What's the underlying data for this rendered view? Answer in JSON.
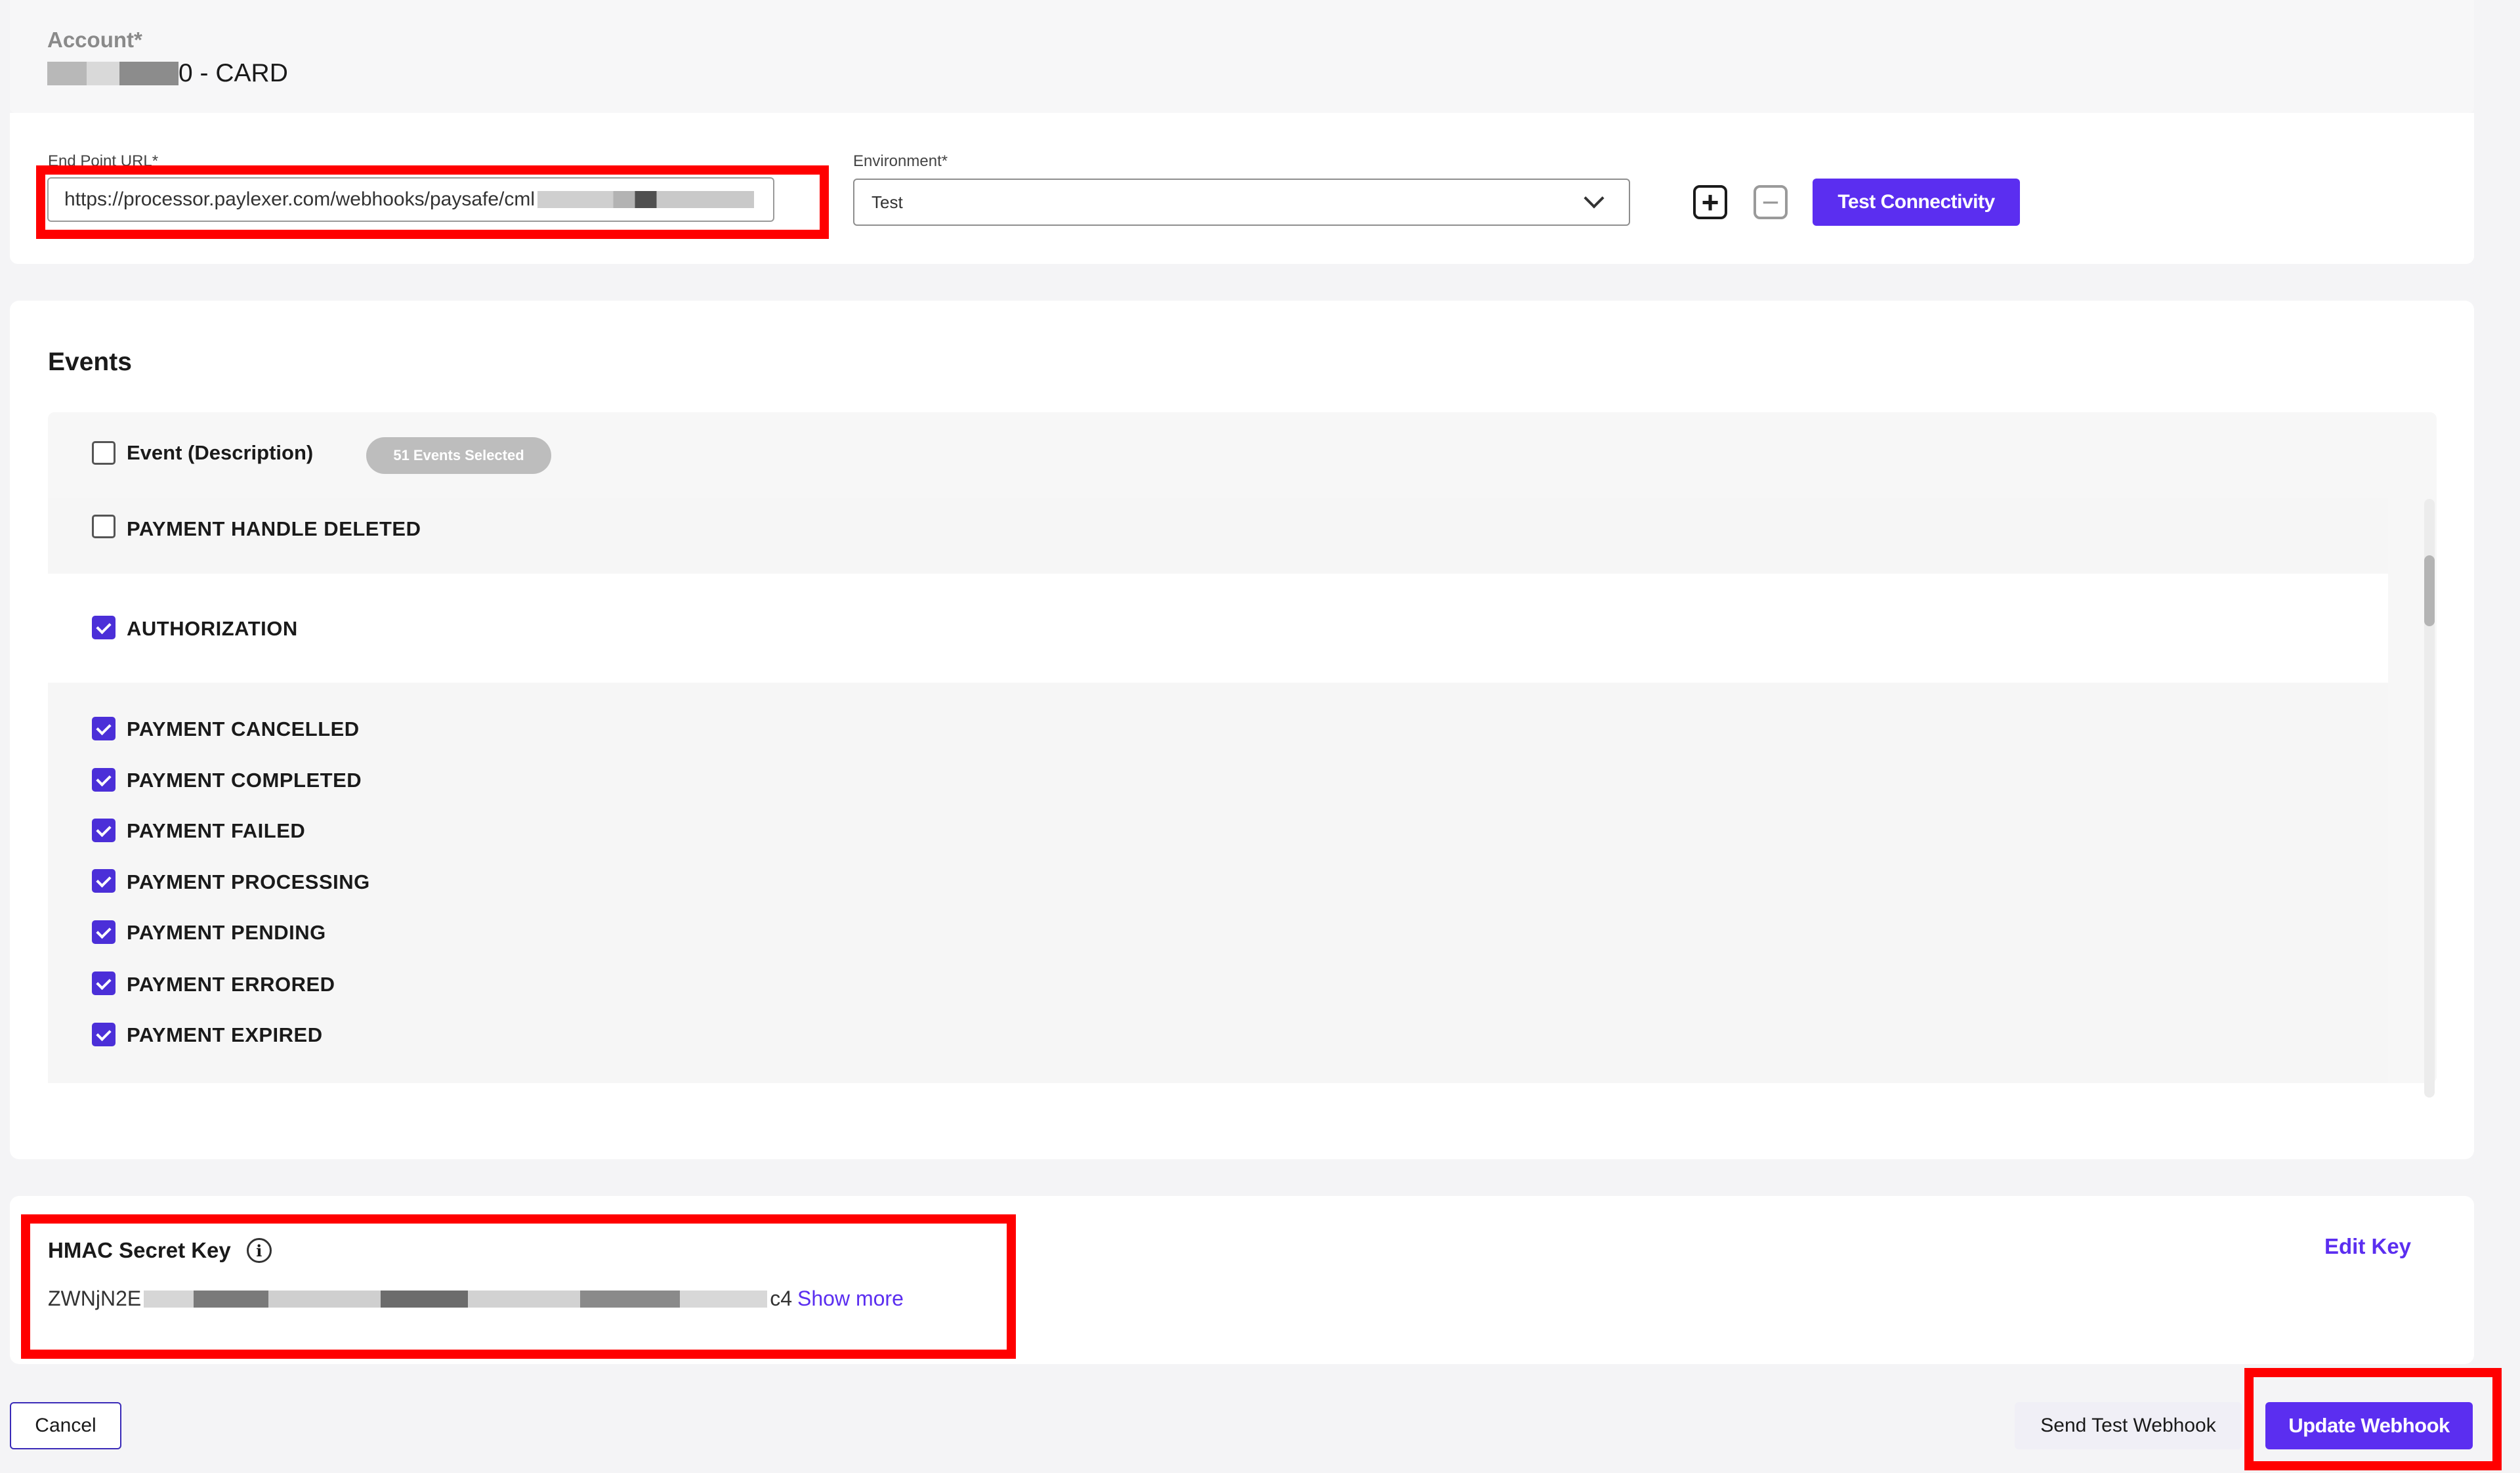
{
  "account": {
    "label": "Account*",
    "value_suffix": "0 - CARD"
  },
  "endpoint": {
    "label": "End Point URL*",
    "url_value": "https://processor.paylexer.com/webhooks/paysafe/cml",
    "env_label": "Environment*",
    "env_value": "Test",
    "test_connectivity_label": "Test Connectivity",
    "plus_symbol": "+",
    "minus_symbol": "−"
  },
  "events": {
    "title": "Events",
    "header_label": "Event (Description)",
    "selected_badge": "51 Events Selected",
    "items": [
      {
        "label": "PAYMENT HANDLE DELETED",
        "checked": false
      },
      {
        "label": "AUTHORIZATION",
        "checked": true
      },
      {
        "label": "PAYMENT CANCELLED",
        "checked": true
      },
      {
        "label": "PAYMENT COMPLETED",
        "checked": true
      },
      {
        "label": "PAYMENT FAILED",
        "checked": true
      },
      {
        "label": "PAYMENT PROCESSING",
        "checked": true
      },
      {
        "label": "PAYMENT PENDING",
        "checked": true
      },
      {
        "label": "PAYMENT ERRORED",
        "checked": true
      },
      {
        "label": "PAYMENT EXPIRED",
        "checked": true
      }
    ]
  },
  "hmac": {
    "title": "HMAC Secret Key",
    "info_symbol": "i",
    "value_prefix": "ZWNjN2E",
    "value_suffix": "c4",
    "show_more": "Show more",
    "edit_key": "Edit Key"
  },
  "footer": {
    "cancel_label": "Cancel",
    "send_test_label": "Send Test Webhook",
    "update_label": "Update Webhook"
  },
  "colors": {
    "accent": "#5b2ef0",
    "checkbox_checked": "#4b2fd8",
    "annotation_red": "#ff0000"
  }
}
